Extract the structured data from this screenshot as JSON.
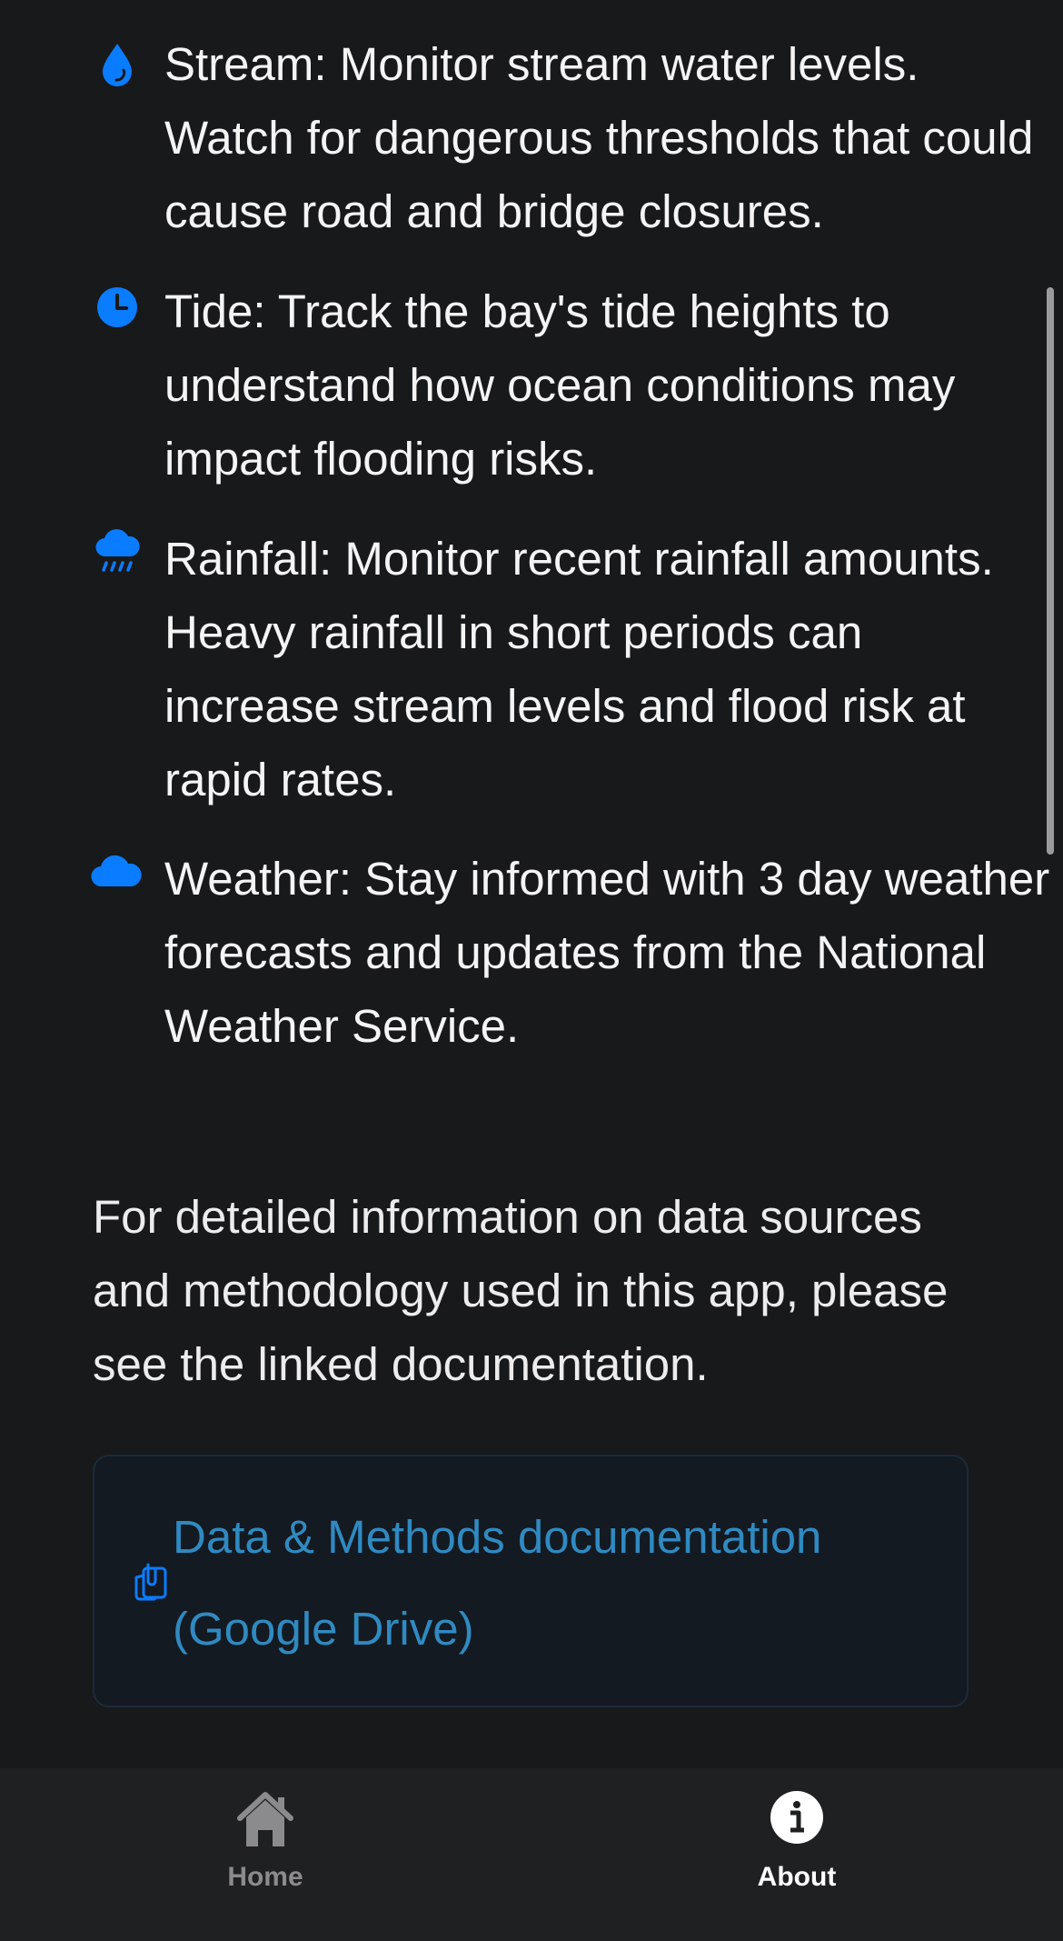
{
  "features": [
    {
      "icon": "water-drop-icon",
      "text": "Stream: Monitor stream water levels. Watch for dangerous thresholds that could cause road and bridge closures."
    },
    {
      "icon": "clock-icon",
      "text": "Tide: Track the bay's tide heights to understand how ocean conditions may impact flooding risks."
    },
    {
      "icon": "rain-cloud-icon",
      "text": "Rainfall: Monitor recent rainfall amounts. Heavy rainfall in short periods can increase stream levels and flood risk at rapid rates."
    },
    {
      "icon": "cloud-icon",
      "text": "Weather: Stay informed with 3 day weather forecasts and updates from the National Weather Service."
    }
  ],
  "info": {
    "text": "For detailed information on data sources and methodology used in this app, please see the linked documentation."
  },
  "doc_link": {
    "icon": "document-clip-icon",
    "label": "Data & Methods documentation (Google Drive)"
  },
  "tabbar": {
    "home": {
      "icon": "home-icon",
      "label": "Home"
    },
    "about": {
      "icon": "info-icon",
      "label": "About"
    }
  },
  "colors": {
    "background": "#18191b",
    "accent": "#0a7cff",
    "link": "#2f8ac1",
    "tabbar": "#1f2022",
    "tab_inactive": "#8b8b8d",
    "tab_active": "#ffffff"
  }
}
